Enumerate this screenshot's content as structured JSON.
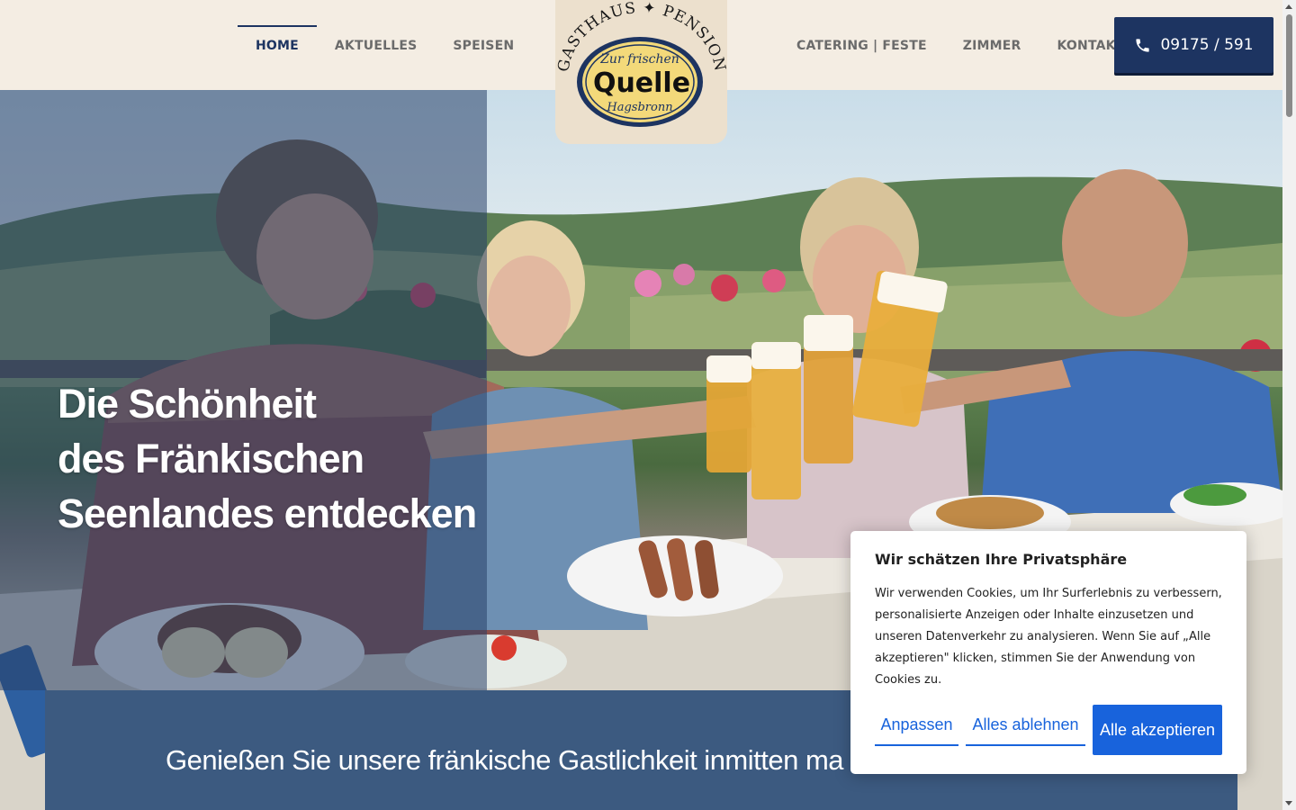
{
  "nav": {
    "left": [
      {
        "label": "HOME",
        "active": true
      },
      {
        "label": "AKTUELLES",
        "active": false
      },
      {
        "label": "SPEISEN",
        "active": false
      }
    ],
    "right": [
      {
        "label": "CATERING | FESTE",
        "active": false
      },
      {
        "label": "ZIMMER",
        "active": false
      },
      {
        "label": "KONTAKT",
        "active": false
      }
    ]
  },
  "phone": {
    "label": "09175 / 591",
    "icon": "phone-icon"
  },
  "logo": {
    "arc_text": "GASTHAUS ✦ PENSION",
    "line1": "Zur frischen",
    "line2": "Quelle",
    "line3": "Hagsbronn"
  },
  "hero": {
    "title_lines": [
      "Die Schönheit",
      "des Fränkischen",
      "Seenlandes entdecken"
    ]
  },
  "intro": {
    "text": "Genießen Sie unsere fränkische Gastlichkeit inmitten ma"
  },
  "cookie": {
    "title": "Wir schätzen Ihre Privatsphäre",
    "body": "Wir verwenden Cookies, um Ihr Surferlebnis zu verbessern, personalisierte Anzeigen oder Inhalte einzusetzen und unseren Datenverkehr zu analysieren. Wenn Sie auf „Alle akzeptieren\" klicken, stimmen Sie der Anwendung von Cookies zu.",
    "customize": "Anpassen",
    "reject": "Alles ablehnen",
    "accept": "Alle akzeptieren"
  },
  "colors": {
    "navy": "#1d3461",
    "cream": "#f4ede3",
    "panel": "#3c5a80",
    "cookie_blue": "#1863dc"
  }
}
